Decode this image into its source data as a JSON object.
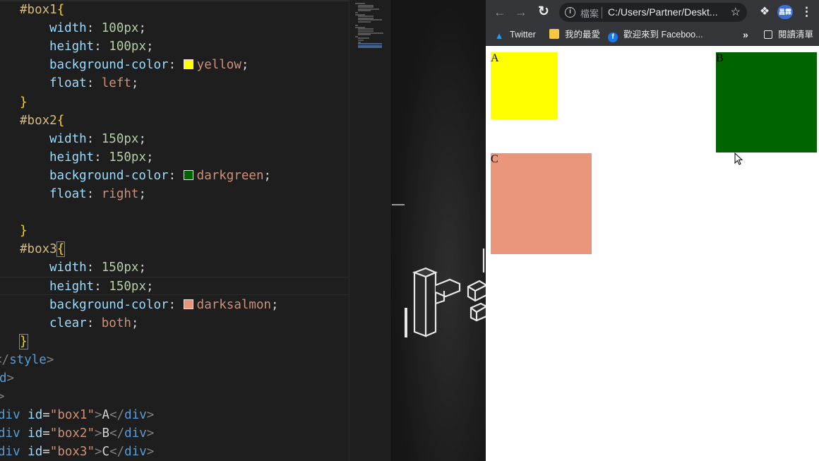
{
  "editor": {
    "lines": [
      {
        "selector": "#box1{"
      },
      {
        "prop": "width",
        "num": "100",
        "unit": "px"
      },
      {
        "prop": "height",
        "num": "100",
        "unit": "px"
      },
      {
        "prop": "background-color",
        "val": "yellow",
        "swatch": "#ffff00"
      },
      {
        "prop": "float",
        "val": "left"
      },
      {
        "close": "}"
      },
      {
        "selector": "#box2{"
      },
      {
        "prop": "width",
        "num": "150",
        "unit": "px"
      },
      {
        "prop": "height",
        "num": "150",
        "unit": "px"
      },
      {
        "prop": "background-color",
        "val": "darkgreen",
        "swatch": "#006400"
      },
      {
        "prop": "float",
        "val": "right"
      },
      {
        "blank": ""
      },
      {
        "close": "}"
      },
      {
        "selector": "#box3{"
      },
      {
        "prop": "width",
        "num": "150",
        "unit": "px"
      },
      {
        "prop": "height",
        "num": "150",
        "unit": "px"
      },
      {
        "prop": "background-color",
        "val": "darksalmon",
        "swatch": "#e9967a"
      },
      {
        "prop": "clear",
        "val": "both"
      },
      {
        "close": "}"
      },
      {
        "endtag": "style"
      },
      {
        "fragment": "d"
      },
      {
        "fragment2": ""
      },
      {
        "div_id": "box1",
        "div_text": "A"
      },
      {
        "div_id": "box2",
        "div_text": "B"
      },
      {
        "div_id": "box3",
        "div_text": "C"
      }
    ]
  },
  "browser": {
    "file_label": "檔案",
    "url": "C:/Users/Partner/Deskt...",
    "avatar_text": "昌霖",
    "bookmarks": {
      "twitter": "Twitter",
      "favorites": "我的最愛",
      "facebook": "歡迎來到 Faceboo...",
      "more": "»",
      "reading_list": "閱讀清單"
    },
    "boxes": [
      {
        "id": "box1",
        "label": "A",
        "color": "#ffff00"
      },
      {
        "id": "box2",
        "label": "B",
        "color": "#006400"
      },
      {
        "id": "box3",
        "label": "C",
        "color": "#e9967a"
      }
    ]
  },
  "colors": {
    "editor_bg": "#1e1e1e",
    "browser_toolbar": "#35363a"
  }
}
